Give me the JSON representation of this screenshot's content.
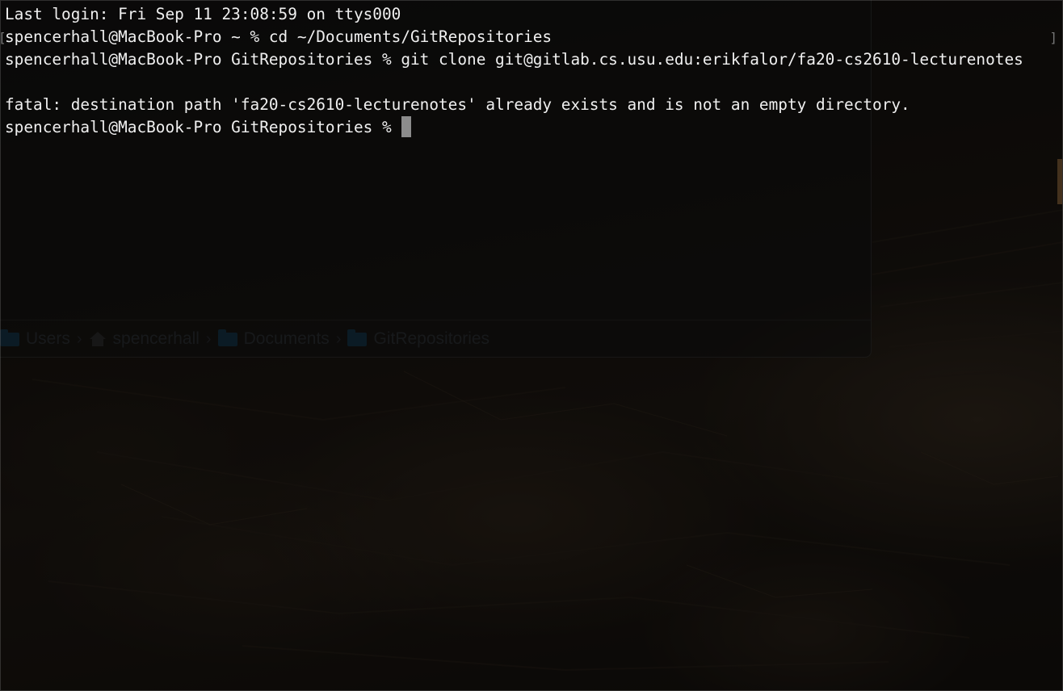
{
  "terminal": {
    "lines": [
      "Last login: Fri Sep 11 23:08:59 on ttys000",
      "spencerhall@MacBook-Pro ~ % cd ~/Documents/GitRepositories",
      "spencerhall@MacBook-Pro GitRepositories % git clone git@gitlab.cs.usu.edu:erikfalor/fa20-cs2610-lecturenotes",
      "",
      "fatal: destination path 'fa20-cs2610-lecturenotes' already exists and is not an empty directory.",
      "spencerhall@MacBook-Pro GitRepositories % "
    ],
    "cursor_color": "#8c8c8c",
    "text_color": "#f0f0f0"
  },
  "finder": {
    "path_bar": [
      {
        "label": "Users",
        "icon": "folder-icon"
      },
      {
        "label": "spencerhall",
        "icon": "home-icon"
      },
      {
        "label": "Documents",
        "icon": "folder-icon"
      },
      {
        "label": "GitRepositories",
        "icon": "folder-icon"
      }
    ],
    "separator": "›"
  },
  "wallpaper": {
    "description_icon": "rocky-landscape-wallpaper"
  }
}
